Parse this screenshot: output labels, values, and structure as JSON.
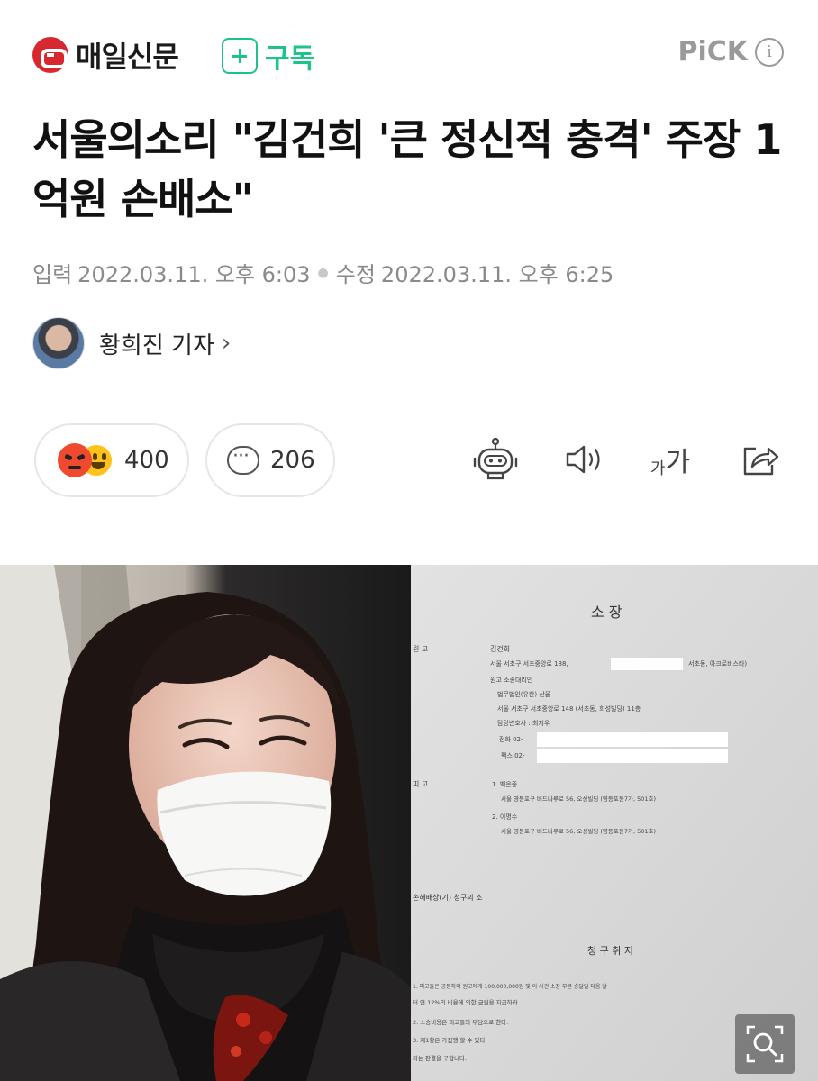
{
  "header": {
    "brand": "매일신문",
    "subscribe_label": "구독",
    "pick_label": "PiCK",
    "pick_info": "i"
  },
  "article": {
    "headline": "서울의소리 \"김건희 '큰 정신적 충격' 주장 1억원 손배소\"",
    "input_label": "입력",
    "input_date": "2022.03.11. 오후 6:03",
    "modified_label": "수정",
    "modified_date": "2022.03.11. 오후 6:25",
    "reporter": "황희진 기자",
    "reporter_chevron": "›"
  },
  "actions": {
    "reaction_count": "400",
    "comment_count": "206",
    "fontsize_small": "가",
    "fontsize_big": "가"
  },
  "document": {
    "title": "소      장",
    "line1": "원    고",
    "line1b": "김건희",
    "line2": "서울 서초구 서초중앙로 188,",
    "line2b": "서초동, 아크로비스타)",
    "line3": "원고 소송대리인",
    "line4": "법무법인(유한) 산율",
    "line5": "서울 서초구 서초중앙로 148 (서초동, 희성빌딩) 11층",
    "line6": "담당변호사 :  최지우",
    "line7": "전화 02-",
    "line8": "팩스 02-",
    "line9": "피    고",
    "line10": "1. 백은종",
    "line11": "서울 영등포구 버드나루로 56, 오성빌딩 (영등포동7가, 501호)",
    "line12": "2. 이명수",
    "line13": "서울 영등포구 버드나루로 56, 오성빌딩 (영등포동7가, 501호)",
    "line14": "손해배상(기) 청구의 소",
    "line15": "청 구 취 지",
    "line16": "1. 피고들은 공동하여 원고에게 100,000,000원 및 이 사건 소장 부본 송달일 다음 날",
    "line17": "터 연 12%의 비율에 의한 금원을 지급하라.",
    "line18": "2. 소송비용은 피고들의 부담으로 한다.",
    "line19": "3. 제1항은 가집행 할 수 있다.",
    "line20": "라는 판결을 구합니다."
  },
  "colors": {
    "brand_red": "#d7282f",
    "subscribe_green": "#1ec28b",
    "meta_gray": "#8a8a8a"
  },
  "icons": [
    "logo-icon",
    "plus-icon",
    "info-icon",
    "angry-emoji-icon",
    "smile-emoji-icon",
    "comment-icon",
    "robot-icon",
    "speaker-icon",
    "font-size-icon",
    "share-icon",
    "zoom-icon"
  ]
}
